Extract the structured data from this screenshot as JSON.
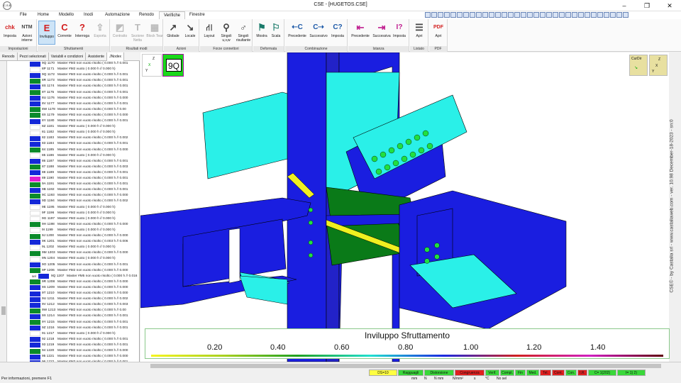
{
  "window": {
    "title": "CSE - [HUGETOS.CSE]",
    "logo_text": "C.S.E.",
    "controls": [
      "–",
      "❐",
      "✕"
    ]
  },
  "menu": {
    "items": [
      "File",
      "Home",
      "Modello",
      "Inodi",
      "Automazione",
      "Renodo",
      "Verifiche",
      "Finestre"
    ],
    "active": "Verifiche"
  },
  "ribbon": {
    "groups": [
      {
        "label": "Impostazioni",
        "buttons": [
          {
            "label": "Imposta",
            "icon": "chk",
            "icon_name": "check-settings-icon"
          },
          {
            "label": "Azioni interne",
            "icon": "NTM",
            "icon_name": "internal-actions-icon"
          }
        ]
      },
      {
        "label": "Sfruttamenti",
        "buttons": [
          {
            "label": "Inviluppo",
            "icon": "E",
            "icon_name": "envelope-icon",
            "active": true
          },
          {
            "label": "Corrente",
            "icon": "C",
            "icon_name": "current-icon"
          },
          {
            "label": "Interroga",
            "icon": "?",
            "icon_name": "query-icon"
          },
          {
            "label": "Esporta",
            "icon": "⇪",
            "icon_name": "export-icon",
            "disabled": true
          }
        ]
      },
      {
        "label": "Risultati modi",
        "buttons": [
          {
            "label": "Contratto",
            "icon": "◩",
            "icon_name": "contract-icon",
            "disabled": true
          },
          {
            "label": "Sezione Netta",
            "icon": "T",
            "icon_name": "net-section-icon",
            "disabled": true
          },
          {
            "label": "Block Tear",
            "icon": "▦",
            "icon_name": "block-tear-icon",
            "disabled": true
          }
        ]
      },
      {
        "label": "Azioni",
        "buttons": [
          {
            "label": "Globale",
            "icon": "↗",
            "icon_name": "global-axes-icon"
          },
          {
            "label": "Locale",
            "icon": "↘",
            "icon_name": "local-axes-icon"
          }
        ]
      },
      {
        "label": "Forze connettori",
        "buttons": [
          {
            "label": "Layout",
            "icon": "⛙",
            "icon_name": "layout-icon"
          },
          {
            "label": "Singoli u,v,w",
            "icon": "⚲",
            "icon_name": "single-uvw-icon"
          },
          {
            "label": "Singoli risultante",
            "icon": "♂",
            "icon_name": "single-resultant-icon"
          }
        ]
      },
      {
        "label": "Deformata",
        "buttons": [
          {
            "label": "Mostra",
            "icon": "⚑",
            "icon_name": "show-deformed-icon"
          },
          {
            "label": "Scala",
            "icon": "⚐",
            "icon_name": "scale-icon"
          }
        ]
      },
      {
        "label": "Combinazione",
        "buttons": [
          {
            "label": "Precedente",
            "icon": "⇠C",
            "icon_name": "previous-combination-icon"
          },
          {
            "label": "Successivo",
            "icon": "C⇢",
            "icon_name": "next-combination-icon"
          },
          {
            "label": "Imposta",
            "icon": "C?",
            "icon_name": "set-combination-icon"
          }
        ]
      },
      {
        "label": "Istanza",
        "buttons": [
          {
            "label": "Precedente",
            "icon": "⇤",
            "icon_name": "previous-instance-icon"
          },
          {
            "label": "Successiva",
            "icon": "⇥",
            "icon_name": "next-instance-icon"
          },
          {
            "label": "Imposta",
            "icon": "I?",
            "icon_name": "set-instance-icon"
          }
        ]
      },
      {
        "label": "Listato",
        "buttons": [
          {
            "label": "Apri",
            "icon": "☰",
            "icon_name": "open-listing-icon"
          }
        ]
      },
      {
        "label": "PDF",
        "buttons": [
          {
            "label": "Apri",
            "icon": "PDF",
            "icon_name": "pdf-icon"
          }
        ]
      }
    ]
  },
  "side_tabs": [
    "Renodo",
    "Pezzi selezionati",
    "Variabili e condizioni",
    "Assistente",
    "JNodex"
  ],
  "side_tabs_active": "JNodex",
  "list_rows": [
    {
      "id": "9Q 1170",
      "text": "Master  #M3 non vuoto risolto ( 0.000 h //  0.001",
      "color": "#1428d8"
    },
    {
      "id": "8P 1171",
      "text": "Master  #M2 vuoto ( 0.000 h //  0.000 h)",
      "color": "#ffffff"
    },
    {
      "id": "9Q 1172",
      "text": "Master  #M3 non vuoto risolto ( 0.000 h //  0.001",
      "color": "#1428d8"
    },
    {
      "id": "8R 1173",
      "text": "Master  #M3 non vuoto risolto ( 0.000 h //  0.001",
      "color": "#0a8a2a"
    },
    {
      "id": "8S 1174",
      "text": "Master  #M3 non vuoto risolto ( 0.000 h //  0.001",
      "color": "#1428d8"
    },
    {
      "id": "8T 1175",
      "text": "Master  #M3 non vuoto risolto ( 0.000 h //  0.001",
      "color": "#0a8a2a"
    },
    {
      "id": "8U 1176",
      "text": "Master  #M2 non vuoto risolto ( 0.000 h //  0.000",
      "color": "#1428d8"
    },
    {
      "id": "8V 1177",
      "text": "Master  #M3 non vuoto risolto ( 0.000 h //  0.001",
      "color": "#1428d8"
    },
    {
      "id": "8W 1178",
      "text": "Master  #M2 non vuoto risolto ( 0.000 h //  0.00",
      "color": "#0a8a2a"
    },
    {
      "id": "8X 1179",
      "text": "Master  #M2 non vuoto risolto ( 0.000 h //  0.000",
      "color": "#0a8a2a"
    },
    {
      "id": "8Y 1180",
      "text": "Master  #M3 non vuoto risolto ( 0.000 h //  0.001",
      "color": "#1428d8"
    },
    {
      "id": "8Z 1181",
      "text": "Master  #M2 vuoto ( 0.000 h //  0.000 h)",
      "color": "#ffffff"
    },
    {
      "id": "81 1182",
      "text": "Master  #M2 vuoto ( 0.000 h //  0.000 h)",
      "color": "#ffffff"
    },
    {
      "id": "82 1183",
      "text": "Master  #M3 non vuoto risolto ( 0.000 h //  0.002",
      "color": "#1428d8"
    },
    {
      "id": "83 1184",
      "text": "Master  #M3 non vuoto risolto ( 0.000 h //  0.001",
      "color": "#1428d8"
    },
    {
      "id": "84 1185",
      "text": "Master  #M2 non vuoto risolto ( 0.000 h //  0.000",
      "color": "#0a8a2a"
    },
    {
      "id": "85 1186",
      "text": "Master  #M2 vuoto ( 0.000 h //  0.000 h)",
      "color": "#ffffff"
    },
    {
      "id": "86 1187",
      "text": "Master  #M3 non vuoto risolto ( 0.000 h //  0.001",
      "color": "#1428d8"
    },
    {
      "id": "87 1188",
      "text": "Master  #M4 non vuoto risolto ( 0.000 h //  0.003",
      "color": "#0a8a2a"
    },
    {
      "id": "88 1189",
      "text": "Master  #M3 non vuoto risolto ( 0.000 h //  0.001",
      "color": "#1428d8"
    },
    {
      "id": "89 1190",
      "text": "Master  #M3 non vuoto risolto ( 0.000 h //  0.001",
      "color": "#e020d0"
    },
    {
      "id": "9A 1191",
      "text": "Master  #M3 non vuoto risolto ( 0.000 h //  0.001",
      "color": "#0a8a2a"
    },
    {
      "id": "9B 1192",
      "text": "Master  #M3 non vuoto risolto ( 0.000 h //  0.001",
      "color": "#1428d8"
    },
    {
      "id": "9C 1193",
      "text": "Master  #M2 non vuoto risolto ( 0.000 h //  0.000",
      "color": "#0a8a2a"
    },
    {
      "id": "9D 1194",
      "text": "Master  #M3 non vuoto risolto ( 0.000 h //  0.002",
      "color": "#1428d8"
    },
    {
      "id": "9E 1195",
      "text": "Master  #M2 vuoto ( 0.000 h //  0.000 h)",
      "color": "#ffffff"
    },
    {
      "id": "9F 1196",
      "text": "Master  #M2 vuoto ( 0.000 h //  0.000 h)",
      "color": "#ffffff"
    },
    {
      "id": "9G 1197",
      "text": "Master  #M3 vuoto ( 0.000 h //  0.000 h)",
      "color": "#ffffff"
    },
    {
      "id": "9H 1198",
      "text": "Master  #M2 non vuoto risolto ( 0.000 h //  0.000",
      "color": "#0a8a2a"
    },
    {
      "id": "9I 1199",
      "text": "Master  #M2 vuoto ( 0.000 h //  0.000 h)",
      "color": "#ffffff"
    },
    {
      "id": "9J 1200",
      "text": "Master  #M2 non vuoto risolto ( 0.000 h //  0.000",
      "color": "#0a8a2a"
    },
    {
      "id": "9K 1201",
      "text": "Master  #M4 non vuoto risolto ( 0.003 h //  0.006",
      "color": "#1428d8"
    },
    {
      "id": "9L 1202",
      "text": "Master  #M2 vuoto ( 0.000 h //  0.000 h)",
      "color": "#ffffff"
    },
    {
      "id": "9M 1203",
      "text": "Master  #M2 non vuoto risolto ( 0.000 h //  0.000",
      "color": "#0a8a2a"
    },
    {
      "id": "9N 1204",
      "text": "Master  #M3 vuoto ( 0.000 h //  0.000 h)",
      "color": "#ffffff"
    },
    {
      "id": "9O 1205",
      "text": "Master  #M3 non vuoto risolto ( 0.000 h //  0.001",
      "color": "#1428d8"
    },
    {
      "id": "9P 1206",
      "text": "Master  #M2 non vuoto risolto ( 0.000 h //  0.000",
      "color": "#0a8a2a"
    },
    {
      "id": "9Q 1207",
      "text": "Master  #M5 non vuoto risolto ( 0.000 h //  0.016",
      "color": "#1428d8",
      "tag": "sel"
    },
    {
      "id": "9R 1208",
      "text": "Master  #M2 non vuoto risolto ( 0.000 h //  0.000",
      "color": "#0a8a2a"
    },
    {
      "id": "9S 1209",
      "text": "Master  #M2 non vuoto risolto ( 0.000 h //  0.000",
      "color": "#1428d8"
    },
    {
      "id": "9T 1210",
      "text": "Master  #M2 non vuoto risolto ( 0.000 h //  0.000",
      "color": "#1428d8"
    },
    {
      "id": "9U 1211",
      "text": "Master  #M3 non vuoto risolto ( 0.000 h //  0.002",
      "color": "#1428d8"
    },
    {
      "id": "9V 1212",
      "text": "Master  #M4 non vuoto risolto ( 0.000 h //  0.003",
      "color": "#1428d8"
    },
    {
      "id": "9W 1213",
      "text": "Master  #M2 non vuoto risolto ( 0.000 h //  0.00",
      "color": "#0a8a2a"
    },
    {
      "id": "9X 1214",
      "text": "Master  #M3 non vuoto risolto ( 0.000 h //  0.001",
      "color": "#1428d8"
    },
    {
      "id": "9Y 1215",
      "text": "Master  #M3 non vuoto risolto ( 0.000 h //  0.001",
      "color": "#0a8a2a"
    },
    {
      "id": "9Z 1216",
      "text": "Master  #M3 non vuoto risolto ( 0.000 h //  0.001",
      "color": "#1428d8"
    },
    {
      "id": "91 1217",
      "text": "Master  #M2 vuoto ( 0.000 h //  0.000 h)",
      "color": "#ffffff"
    },
    {
      "id": "92 1218",
      "text": "Master  #M3 non vuoto risolto ( 0.000 h //  0.001",
      "color": "#1428d8"
    },
    {
      "id": "93 1219",
      "text": "Master  #M3 non vuoto risolto ( 0.000 h //  0.001",
      "color": "#1428d8"
    },
    {
      "id": "94 1220",
      "text": "Master  #M2 non vuoto risolto ( 0.000 h //  0.000",
      "color": "#0a8a2a"
    },
    {
      "id": "95 1221",
      "text": "Master  #M3 non vuoto risolto ( 0.000 h //  0.000",
      "color": "#1428d8"
    },
    {
      "id": "96 1222",
      "text": "Master  #M3 non vuoto risolto ( 0.000 h //  0.001",
      "color": "#1428d8"
    }
  ],
  "viewport": {
    "node_label": "9Q",
    "axis_z": "Z",
    "axis_y": "Y",
    "axis_x": "X",
    "curdir_label": "CurDir",
    "credit": "CSE© - by Castalia srl - www.castaliaweb.com - ver. 10.98 December-18-2023 - sn:0",
    "colors": {
      "blue": "#1a1ee0",
      "cyan": "#2af0e8",
      "green": "#0a7a18",
      "yellow": "#f0f020"
    }
  },
  "legend": {
    "title": "Inviluppo Sfruttamento",
    "ticks": [
      "0.20",
      "0.40",
      "0.60",
      "0.80",
      "1.00",
      "1.20",
      "1.40"
    ],
    "gradient": [
      "#f5f520",
      "#a8d020",
      "#20a020",
      "#20e0d0",
      "#1a2ae0",
      "#d02020",
      "#d020c0",
      "#600010"
    ]
  },
  "status": {
    "help": "Per informazioni, premere F1",
    "indicators": [
      {
        "text": "DS=10",
        "bg": "#ffff40"
      },
      {
        "text": "Ragguagli",
        "bg": "#3ad83a"
      },
      {
        "text": "Distorsione",
        "bg": "#3ad83a"
      },
      {
        "text": "Congruenza",
        "bg": "#e02020"
      },
      {
        "text": "Verif.",
        "bg": "#3ad83a"
      },
      {
        "text": "Compl.",
        "bg": "#3ad83a"
      },
      {
        "text": "Fin",
        "bg": "#3ad83a"
      },
      {
        "text": "Med.",
        "bg": "#3ad83a"
      },
      {
        "text": "Tel.",
        "bg": "#e02020"
      },
      {
        "text": "Cont.",
        "bg": "#e02020"
      },
      {
        "text": "Con.",
        "bg": "#3ad83a"
      },
      {
        "text": "I.R.",
        "bg": "#e02020"
      },
      {
        "text": "C=  1(202)",
        "bg": "#3ad83a"
      },
      {
        "text": "I=  1)  2)",
        "bg": "#3ad83a"
      }
    ],
    "units": [
      "mm",
      "N",
      "N mm",
      "N/mm²",
      "s",
      "°C",
      "No sel"
    ]
  }
}
